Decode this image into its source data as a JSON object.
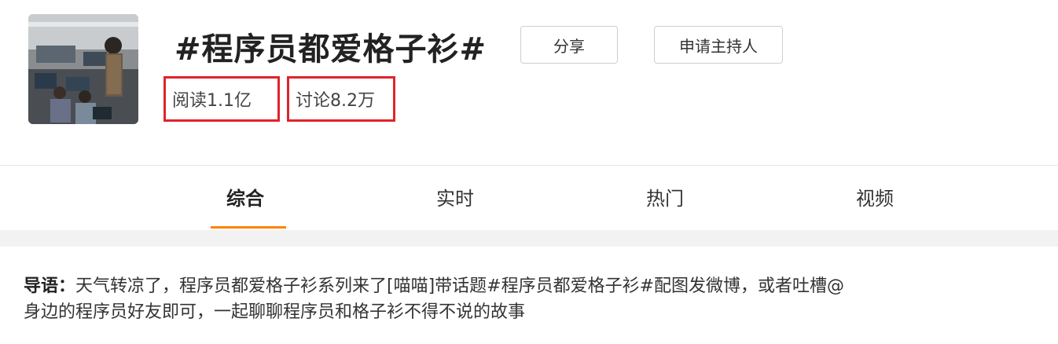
{
  "topic": {
    "title": "#程序员都爱格子衫#",
    "share_label": "分享",
    "host_label": "申请主持人",
    "reads": "阅读1.1亿",
    "discussions": "讨论8.2万"
  },
  "tabs": [
    {
      "label": "综合",
      "active": true
    },
    {
      "label": "实时",
      "active": false
    },
    {
      "label": "热门",
      "active": false
    },
    {
      "label": "视频",
      "active": false
    }
  ],
  "intro": {
    "label": "导语：",
    "line1": "天气转凉了，程序员都爱格子衫系列来了[喵喵]带话题#程序员都爱格子衫#配图发微博，或者吐槽@",
    "line2": "身边的程序员好友即可，一起聊聊程序员和格子衫不得不说的故事"
  },
  "colors": {
    "highlight_box": "#e0242a",
    "tab_underline": "#ff8200"
  }
}
